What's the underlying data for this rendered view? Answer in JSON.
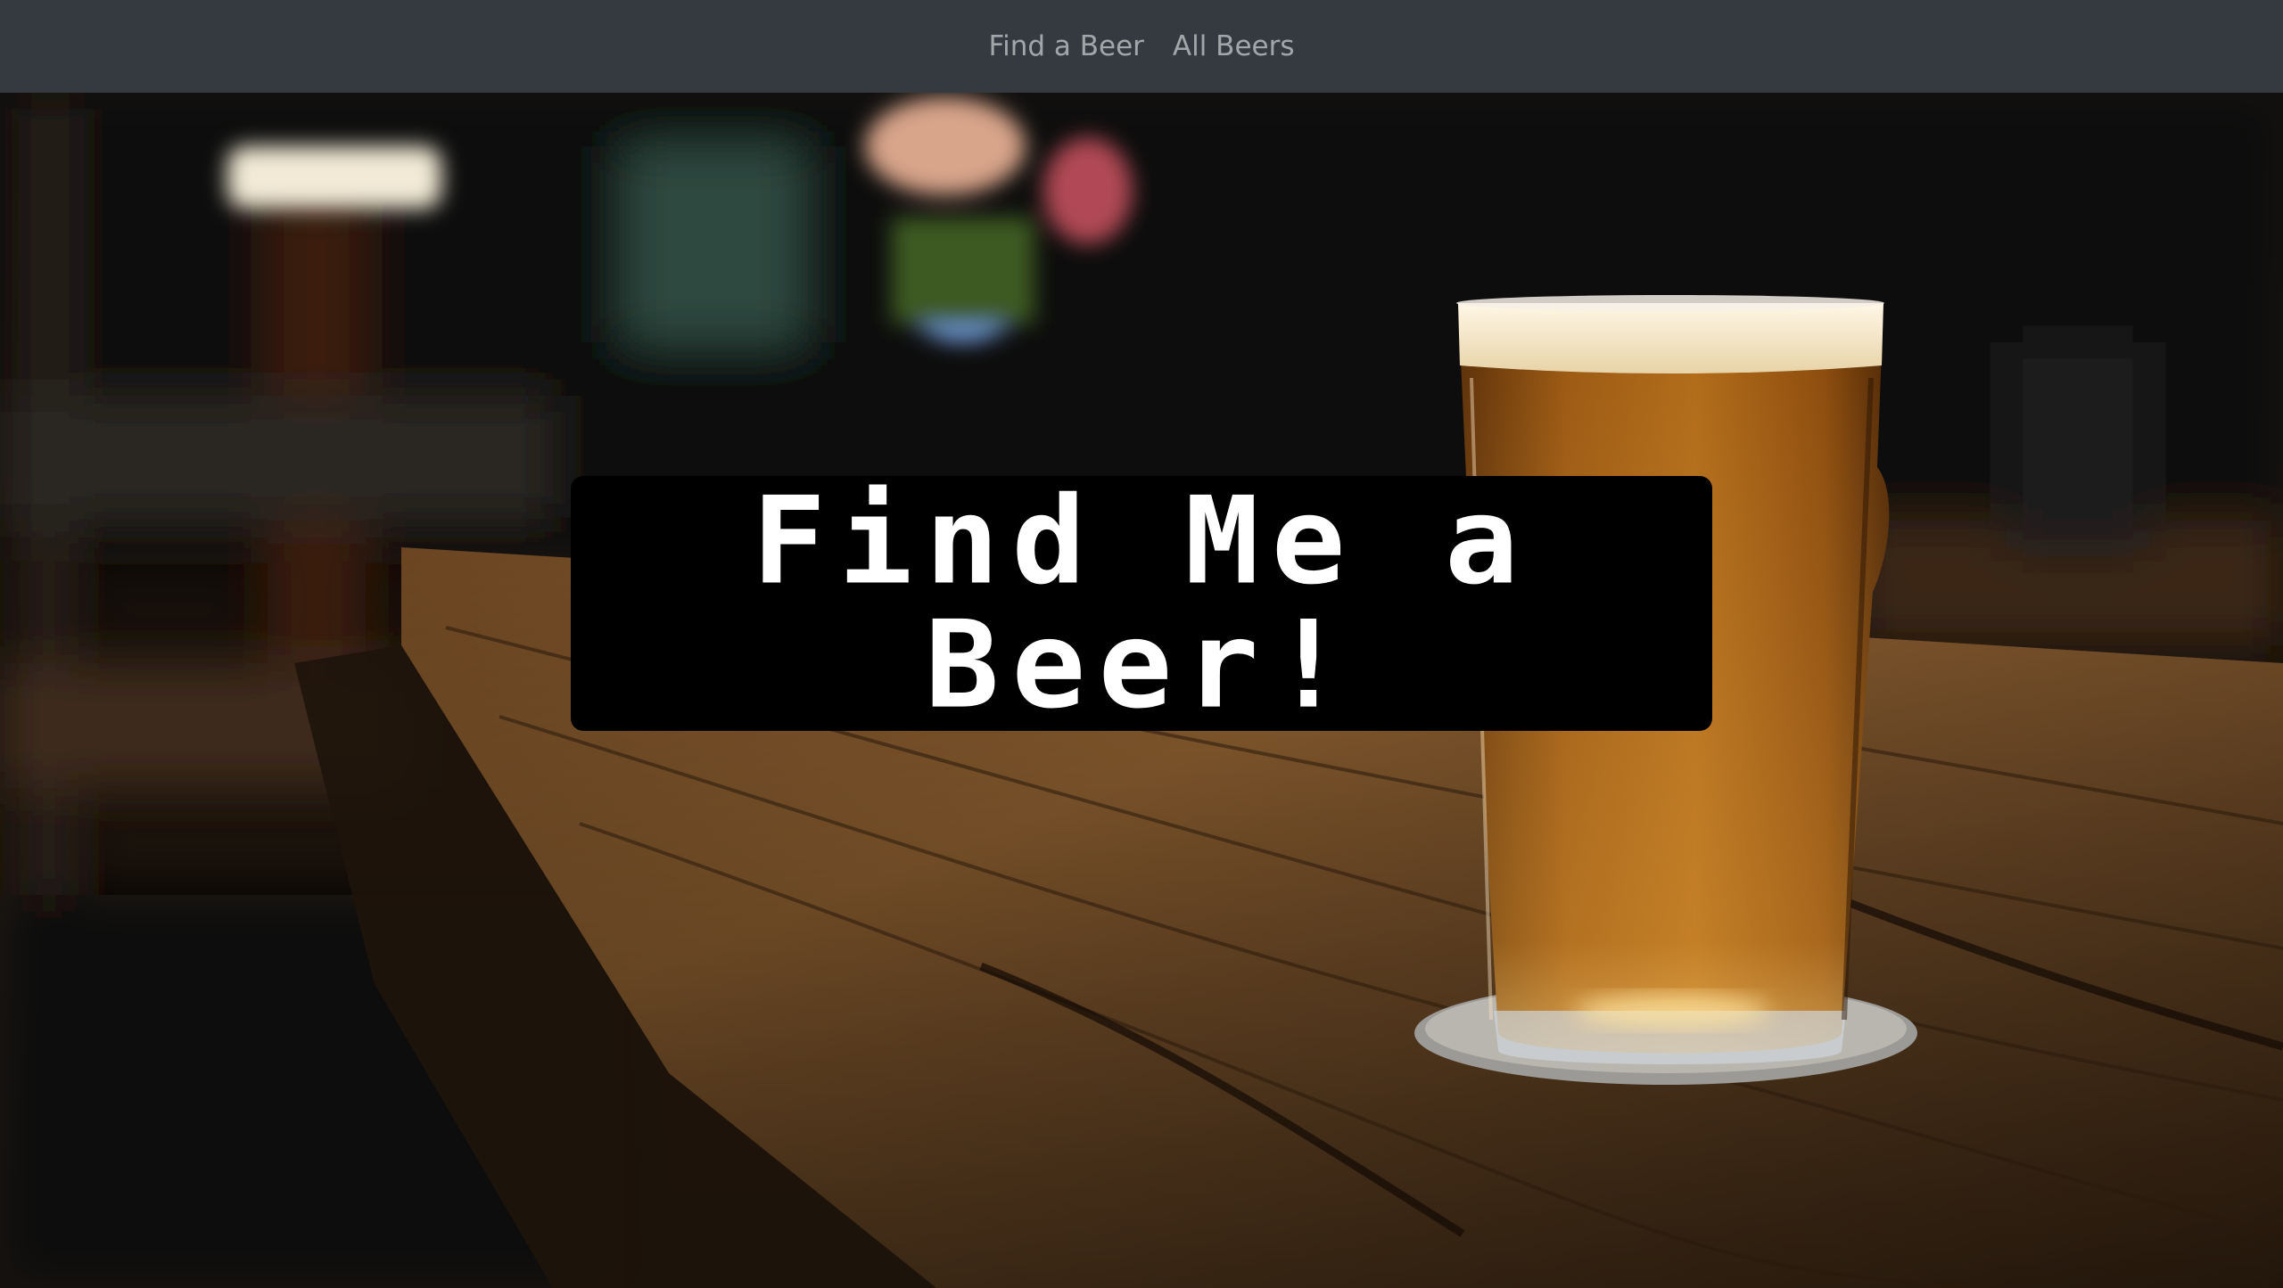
{
  "nav": {
    "links": [
      {
        "label": "Find a Beer"
      },
      {
        "label": "All Beers"
      }
    ]
  },
  "hero": {
    "title": "Find Me a Beer!",
    "image_icon": "beer-on-bar-photo"
  },
  "colors": {
    "navbar_bg": "#343a40",
    "nav_link": "#9a9da0",
    "title_box_bg": "#000000",
    "title_text": "#ffffff"
  }
}
